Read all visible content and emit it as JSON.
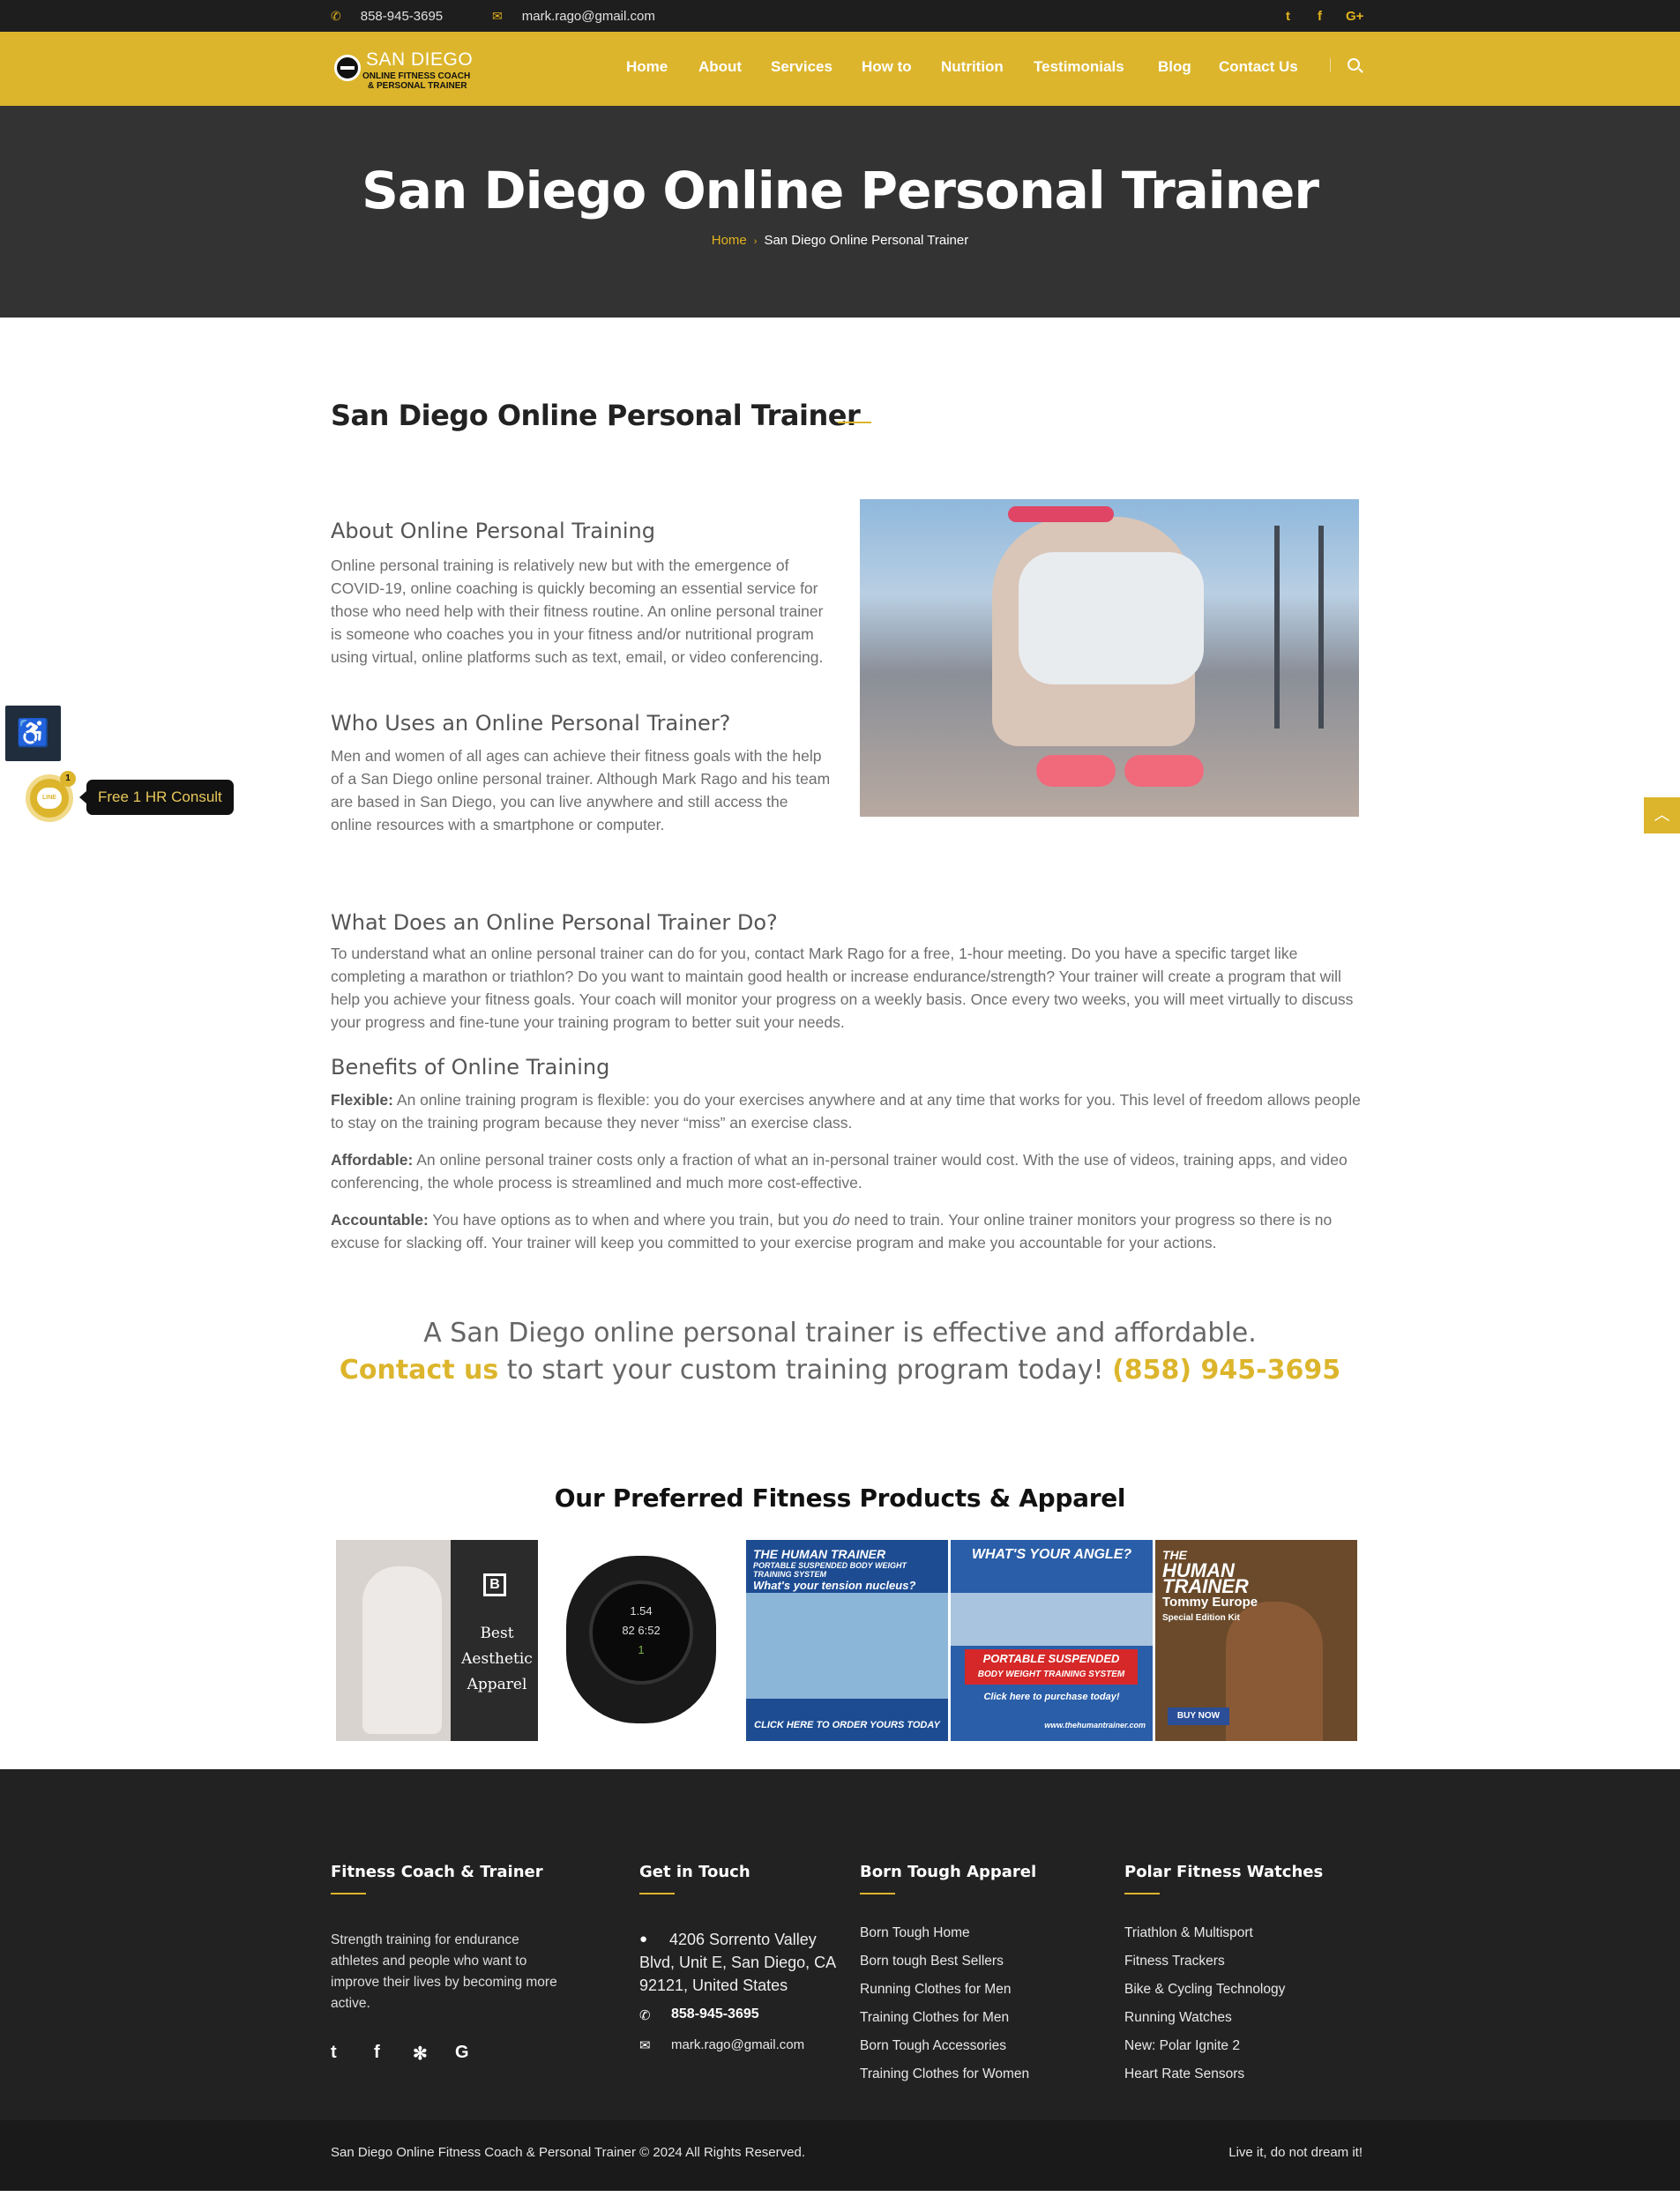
{
  "topbar": {
    "phone": "858-945-3695",
    "email": "mark.rago@gmail.com",
    "phone_icon": "phone-icon",
    "email_icon": "envelope-icon",
    "social": [
      "twitter-icon",
      "facebook-icon",
      "google-plus-icon"
    ]
  },
  "logo": {
    "line1": "SAN DIEGO",
    "line2": "ONLINE FITNESS COACH",
    "line3": "& PERSONAL TRAINER"
  },
  "nav": {
    "items": [
      {
        "label": "Home"
      },
      {
        "label": "About"
      },
      {
        "label": "Services"
      },
      {
        "label": "How to"
      },
      {
        "label": "Nutrition"
      },
      {
        "label": "Testimonials"
      },
      {
        "label": "Blog"
      },
      {
        "label": "Contact Us"
      }
    ]
  },
  "hero": {
    "title": "San Diego Online Personal Trainer",
    "breadcrumb": [
      "Home",
      "San Diego Online Personal Trainer"
    ]
  },
  "main": {
    "section_title": "San Diego Online Personal Trainer",
    "about_heading": "About Online Personal Training",
    "about_text": "Online personal training is relatively new but with the emergence of COVID-19, online coaching is quickly becoming an essential service for those who need help with their fitness routine. An online personal trainer is someone who coaches you in your fitness and/or nutritional program using virtual, online platforms such as text, email, or video conferencing.",
    "who_heading": "Who Uses an Online Personal Trainer?",
    "who_text": "Men and women of all ages can achieve their fitness goals with the help of a San Diego online personal trainer.  Although Mark Rago and his team are based in San Diego, you can live anywhere and still access the online resources with a smartphone or computer.",
    "what_heading": "What Does an Online Personal Trainer Do?",
    "what_text": "To understand what an online personal trainer can do for you, contact Mark Rago for a free, 1-hour meeting. Do you have a specific target like completing a marathon or triathlon? Do you want to maintain good health or increase endurance/strength? Your trainer will create a program that will help you achieve your fitness goals.  Your coach will monitor your progress on a weekly basis.  Once every two weeks, you will meet virtually to discuss your progress and fine-tune your training program to better suit your needs.",
    "benefits_heading": "Benefits of Online Training",
    "benefits": [
      {
        "label": "Flexible:",
        "text": " An online training program is flexible: you do your exercises anywhere and at any time that works for you. This level of freedom allows people to stay on the training program because they never “miss” an exercise class."
      },
      {
        "label": "Affordable:",
        "text": " An online personal trainer costs only a fraction of what an in-personal trainer would cost. With the use of videos, training apps, and video conferencing, the whole process is streamlined and much more cost-effective."
      },
      {
        "label": "Accountable:",
        "text_before": " You have options as to when and where you train, but you ",
        "emphasis": "do",
        "text_after": " need to train. Your online trainer monitors your progress so there is no excuse for slacking off.  Your trainer will keep you committed to your exercise program and make you accountable for your actions."
      }
    ],
    "tagline_1": "A San Diego online personal trainer is effective and affordable.",
    "tagline_link": "Contact us",
    "tagline_2": " to start your custom training program today! ",
    "tagline_phone": "(858) 945-3695"
  },
  "products": {
    "title": "Our Preferred Fitness Products & Apparel",
    "bt_logo": "B",
    "bt_text": [
      "Best",
      "Aesthetic",
      "Apparel"
    ],
    "watch_lines": [
      "1.54",
      "82  6:52",
      "1"
    ],
    "banner1_title": "THE HUMAN TRAINER",
    "banner1_sub": "PORTABLE SUSPENDED BODY WEIGHT TRAINING SYSTEM",
    "banner1_q": "What's your tension nucleus?",
    "banner1_cta": "CLICK HERE TO ORDER YOURS TODAY",
    "banner2_q": "WHAT'S YOUR ANGLE?",
    "banner2_red1": "PORTABLE SUSPENDED",
    "banner2_red2": "BODY WEIGHT TRAINING SYSTEM",
    "banner2_cta": "Click here to purchase today!",
    "banner2_url": "www.thehumantrainer.com",
    "banner3_l1": "THE",
    "banner3_l2": "HUMAN",
    "banner3_l3": "TRAINER",
    "banner3_l4": "Tommy Europe",
    "banner3_l5": "Special Edition Kit",
    "banner3_buy": "BUY NOW"
  },
  "footer": {
    "col1_title": "Fitness Coach & Trainer",
    "col1_text": "Strength training for endurance athletes and people who want to improve their lives by becoming more active.",
    "col1_social": [
      "twitter-icon",
      "facebook-icon",
      "yelp-icon",
      "google-icon"
    ],
    "col2_title": "Get in Touch",
    "address": "4206 Sorrento Valley Blvd, Unit E, San Diego, CA 92121, United States",
    "phone": "858-945-3695",
    "email": "mark.rago@gmail.com",
    "col3_title": "Born Tough Apparel",
    "col3_links": [
      "Born Tough Home",
      "Born tough Best Sellers",
      "Running Clothes for Men",
      "Training Clothes for Men",
      "Born Tough Accessories",
      "Training Clothes for Women"
    ],
    "col4_title": "Polar Fitness Watches",
    "col4_links": [
      "Triathlon & Multisport",
      "Fitness Trackers",
      "Bike & Cycling Technology",
      "Running Watches",
      "New: Polar Ignite 2",
      "Heart Rate Sensors"
    ],
    "copyright": "San Diego Online Fitness Coach & Personal Trainer © 2024 All Rights Reserved.",
    "motto": "Live it, do not dream it!"
  },
  "widgets": {
    "consult_label": "Free 1 HR Consult",
    "line_badge": "1",
    "line_label": "LINE"
  },
  "colors": {
    "accent": "#dcb52c",
    "dark": "#333333",
    "footer": "#222222"
  }
}
